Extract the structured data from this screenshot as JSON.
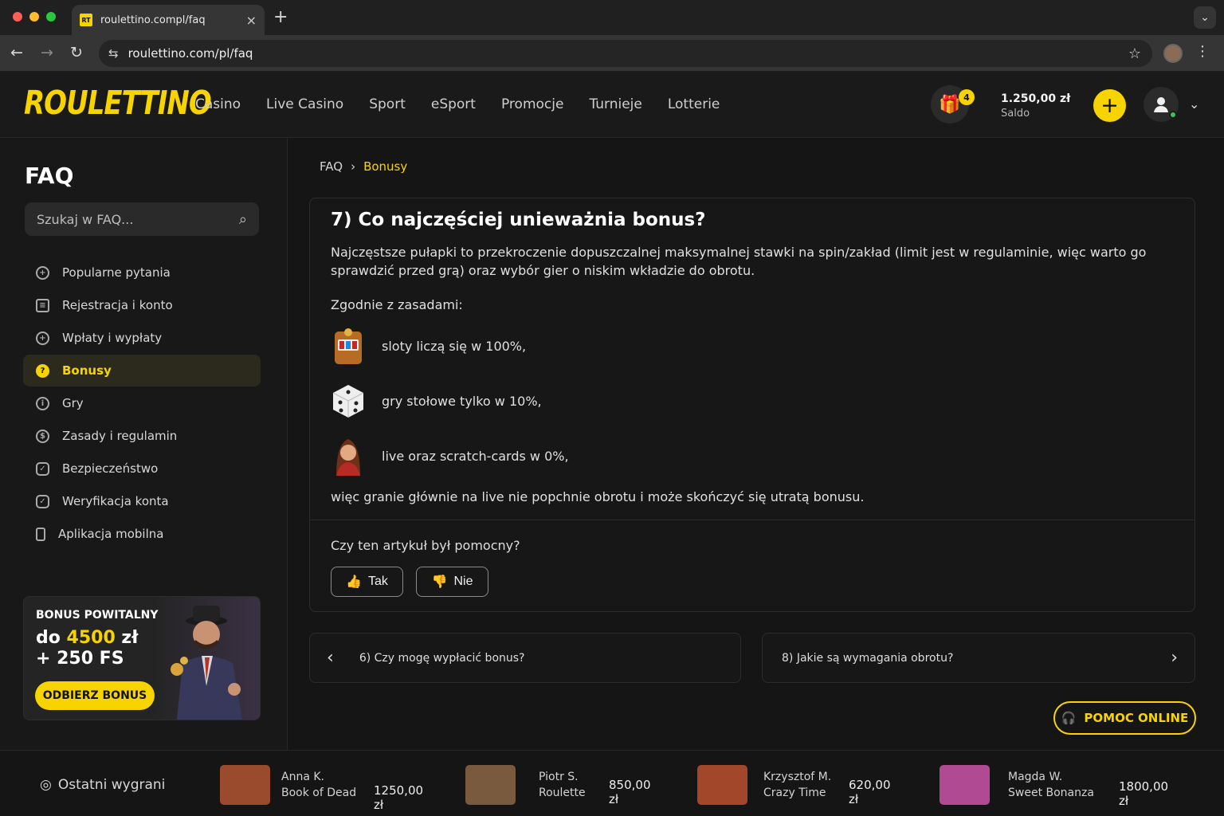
{
  "browser": {
    "tab_title": "roulettino.compl/faq",
    "url": "roulettino.com/pl/faq",
    "tab_close": "×",
    "new_tab": "+",
    "favicon_text": "RT"
  },
  "header": {
    "logo": "ROULETTINO",
    "nav": [
      "Casino",
      "Live Casino",
      "Sport",
      "eSport",
      "Promocje",
      "Turnieje",
      "Lotterie"
    ],
    "gift_count": "4",
    "balance": "1.250,00 zł",
    "balance_label": "Saldo",
    "deposit_symbol": "+"
  },
  "sidebar": {
    "title": "FAQ",
    "search_placeholder": "Szukaj w FAQ...",
    "items": [
      {
        "label": "Popularne pytania",
        "icon": "star-icon"
      },
      {
        "label": "Rejestracja i konto",
        "icon": "clipboard-icon"
      },
      {
        "label": "Wpłaty i wypłaty",
        "icon": "money-icon"
      },
      {
        "label": "Bonusy",
        "icon": "question-icon",
        "active": true
      },
      {
        "label": "Gry",
        "icon": "info-icon"
      },
      {
        "label": "Zasady i regulamin",
        "icon": "rules-icon"
      },
      {
        "label": "Bezpieczeństwo",
        "icon": "shield-icon"
      },
      {
        "label": "Weryfikacja konta",
        "icon": "verified-icon"
      },
      {
        "label": "Aplikacja mobilna",
        "icon": "phone-icon"
      }
    ],
    "promo": {
      "title": "BONUS POWITALNY",
      "amount_prefix": "do ",
      "amount_value": "4500",
      "amount_suffix": " zł",
      "spins": "+ 250 FS",
      "button": "ODBIERZ BONUS"
    }
  },
  "breadcrumb": {
    "root": "FAQ",
    "separator": "›",
    "current": "Bonusy"
  },
  "article": {
    "title": "7) Co najczęściej unieważnia bonus?",
    "paragraph": "Najczęstsze pułapki to przekroczenie dopuszczalnej maksymalnej stawki na spin/zakład (limit jest w regulaminie, więc warto go sprawdzić przed grą) oraz wybór gier o niskim wkładzie do obrotu.",
    "rules_intro": "Zgodnie z zasadami:",
    "rules": [
      {
        "text": "sloty liczą się w 100%,",
        "icon": "slot-machine-icon"
      },
      {
        "text": "gry stołowe tylko w 10%,",
        "icon": "dice-icon"
      },
      {
        "text": "live oraz scratch-cards w 0%,",
        "icon": "live-dealer-icon"
      }
    ],
    "conclusion": "więc granie głównie na live nie popchnie obrotu i może skończyć się utratą bonusu.",
    "helpful_question": "Czy ten artykuł był pomocny?",
    "yes": "Tak",
    "no": "Nie"
  },
  "pager": {
    "previous": "6) Czy mogę wypłacić bonus?",
    "next": "8) Jakie są wymagania obrotu?"
  },
  "support": {
    "label": "POMOC ONLINE"
  },
  "recent_wins": {
    "label": "Ostatni wygrani",
    "items": [
      {
        "name": "Anna K.",
        "game": "Book of Dead",
        "amount": "1250,00 zł",
        "thumb_color": "#9b4b2d"
      },
      {
        "name": "Piotr S.",
        "game": "Roulette",
        "amount": "850,00 zł",
        "thumb_color": "#7a5a3e"
      },
      {
        "name": "Krzysztof M.",
        "game": "Crazy Time",
        "amount": "620,00 zł",
        "thumb_color": "#a3472a"
      },
      {
        "name": "Magda W.",
        "game": "Sweet Bonanza",
        "amount": "1800,00 zł",
        "thumb_color": "#b04b93"
      }
    ]
  },
  "colors": {
    "accent": "#f7d400",
    "background": "#151515",
    "online": "#42c15b"
  }
}
